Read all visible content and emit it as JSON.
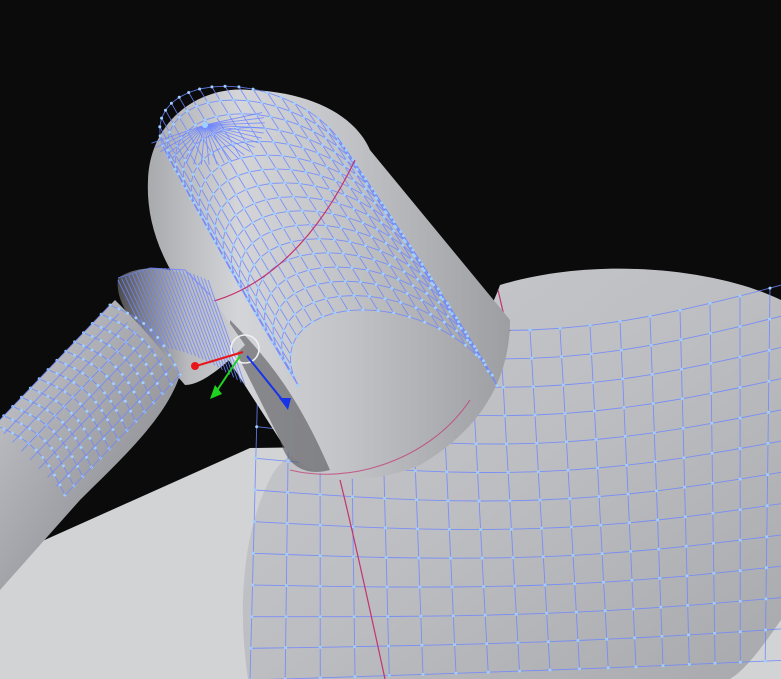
{
  "viewport": {
    "background_color": "#0b0b0c",
    "ground_color": "#d2d3d5",
    "mesh_surface_color": "#c8c9cd",
    "mesh_shadow_color": "#4a4b4f",
    "wire_color": "#6e86ff",
    "vertex_color": "#9fd0ff",
    "seam_color": "#c2336f"
  },
  "gizmo": {
    "x_axis_color": "#e8161b",
    "y_axis_color": "#1fd31f",
    "z_axis_color": "#1733e8",
    "ring_color": "#f0f0f0",
    "icon": "translate-gizmo-icon"
  }
}
